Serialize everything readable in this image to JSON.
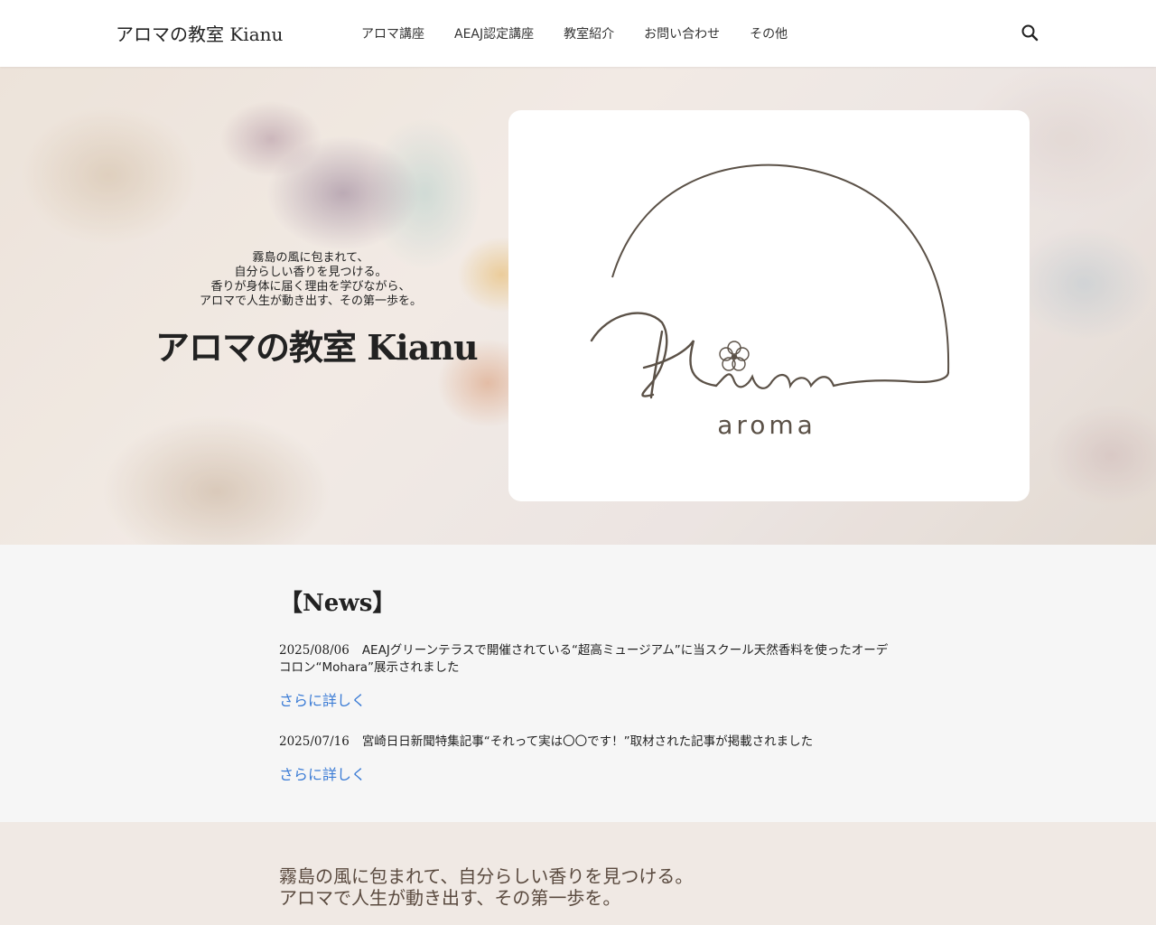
{
  "header": {
    "site_title": "アロマの教室 Kianu",
    "nav": [
      {
        "label": "アロマ講座"
      },
      {
        "label": "AEAJ認定講座"
      },
      {
        "label": "教室紹介"
      },
      {
        "label": "お問い合わせ"
      },
      {
        "label": "その他"
      }
    ],
    "search_icon": "search-icon"
  },
  "hero": {
    "tagline_lines": [
      "霧島の風に包まれて、",
      "自分らしい香りを見つける。",
      "香りが身体に届く理由を学びながら、",
      "アロマで人生が動き出す、その第一歩を。"
    ],
    "title": "アロマの教室 Kianu",
    "logo": {
      "script_text": "Kianu",
      "sub_text": "aroma",
      "icon": "flower-icon",
      "line_color": "#5b5147"
    }
  },
  "news": {
    "heading": "【News】",
    "items": [
      {
        "date": "2025/08/06",
        "text": "AEAJグリーンテラスで開催されている“超高ミュージアム”に当スクール天然香料を使ったオーデコロン“Mohara”展示されました",
        "more": "さらに詳しく"
      },
      {
        "date": "2025/07/16",
        "text": "宮崎日日新聞特集記事“それって実は〇〇です！”取材された記事が掲載されました",
        "more": "さらに詳しく"
      }
    ],
    "link_color": "#3a7bd5"
  },
  "intro": {
    "lines": [
      "霧島の風に包まれて、自分らしい香りを見つける。",
      "アロマで人生が動き出す、その第一歩を。"
    ]
  }
}
